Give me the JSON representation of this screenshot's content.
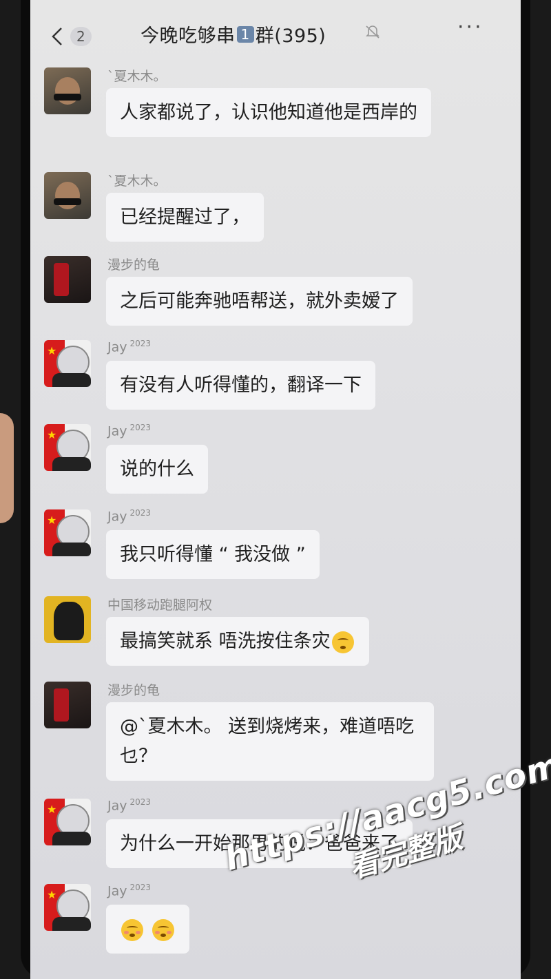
{
  "header": {
    "unread_count": "2",
    "title": "今晚吃够串",
    "group_number": "1",
    "title_suffix": "群(395)",
    "more_label": "···"
  },
  "messages": [
    {
      "sender": "`夏木木。",
      "sender_badge": "",
      "text": "人家都说了，认识他知道他是西岸的"
    },
    {
      "sender": "`夏木木。",
      "sender_badge": "",
      "text": "已经提醒过了，"
    },
    {
      "sender": "漫步的龟",
      "sender_badge": "",
      "text": "之后可能奔驰唔帮送，就外卖嫒了"
    },
    {
      "sender": "Jay",
      "sender_badge": "2023",
      "text": "有没有人听得懂的，翻译一下"
    },
    {
      "sender": "Jay",
      "sender_badge": "2023",
      "text": "说的什么"
    },
    {
      "sender": "Jay",
      "sender_badge": "2023",
      "text": "我只听得懂 “ 我没做 ”"
    },
    {
      "sender": "中国移动跑腿阿权",
      "sender_badge": "",
      "text": "最搞笑就系  唔洗按住条灾"
    },
    {
      "sender": "漫步的龟",
      "sender_badge": "",
      "text": "@`夏木木。 送到烧烤来，难道唔吃乜？"
    },
    {
      "sender": "Jay",
      "sender_badge": "2023",
      "text": "为什么一开始那男的说：爸爸来了"
    },
    {
      "sender": "Jay",
      "sender_badge": "2023",
      "text": ""
    }
  ],
  "watermark": {
    "url": "https://aacg5.com",
    "subtitle": "看完整版"
  }
}
